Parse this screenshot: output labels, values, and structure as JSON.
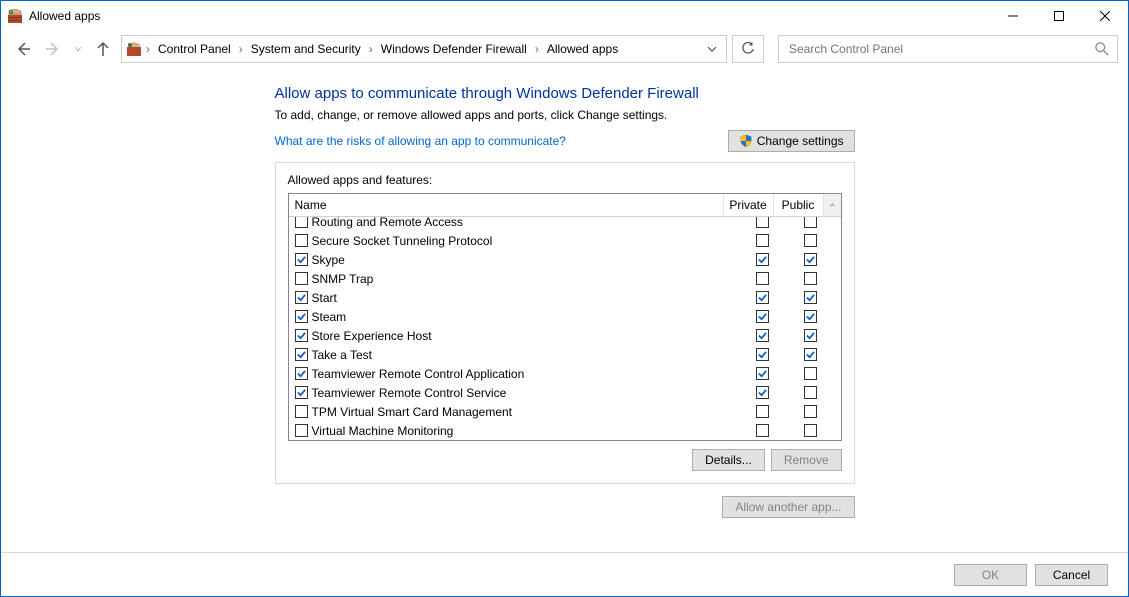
{
  "window": {
    "title": "Allowed apps"
  },
  "breadcrumbs": {
    "items": [
      "Control Panel",
      "System and Security",
      "Windows Defender Firewall",
      "Allowed apps"
    ]
  },
  "search": {
    "placeholder": "Search Control Panel"
  },
  "main": {
    "heading": "Allow apps to communicate through Windows Defender Firewall",
    "subtext": "To add, change, or remove allowed apps and ports, click Change settings.",
    "risks_link": "What are the risks of allowing an app to communicate?",
    "change_settings": "Change settings",
    "group_label": "Allowed apps and features:",
    "columns": {
      "name": "Name",
      "private": "Private",
      "public": "Public"
    },
    "rows": [
      {
        "name": "Routing and Remote Access",
        "enabled": false,
        "private": false,
        "public": false
      },
      {
        "name": "Secure Socket Tunneling Protocol",
        "enabled": false,
        "private": false,
        "public": false
      },
      {
        "name": "Skype",
        "enabled": true,
        "private": true,
        "public": true
      },
      {
        "name": "SNMP Trap",
        "enabled": false,
        "private": false,
        "public": false
      },
      {
        "name": "Start",
        "enabled": true,
        "private": true,
        "public": true
      },
      {
        "name": "Steam",
        "enabled": true,
        "private": true,
        "public": true
      },
      {
        "name": "Store Experience Host",
        "enabled": true,
        "private": true,
        "public": true
      },
      {
        "name": "Take a Test",
        "enabled": true,
        "private": true,
        "public": true
      },
      {
        "name": "Teamviewer Remote Control Application",
        "enabled": true,
        "private": true,
        "public": false
      },
      {
        "name": "Teamviewer Remote Control Service",
        "enabled": true,
        "private": true,
        "public": false
      },
      {
        "name": "TPM Virtual Smart Card Management",
        "enabled": false,
        "private": false,
        "public": false
      },
      {
        "name": "Virtual Machine Monitoring",
        "enabled": false,
        "private": false,
        "public": false
      }
    ],
    "details_btn": "Details...",
    "remove_btn": "Remove",
    "allow_another_btn": "Allow another app..."
  },
  "footer": {
    "ok": "OK",
    "cancel": "Cancel"
  }
}
